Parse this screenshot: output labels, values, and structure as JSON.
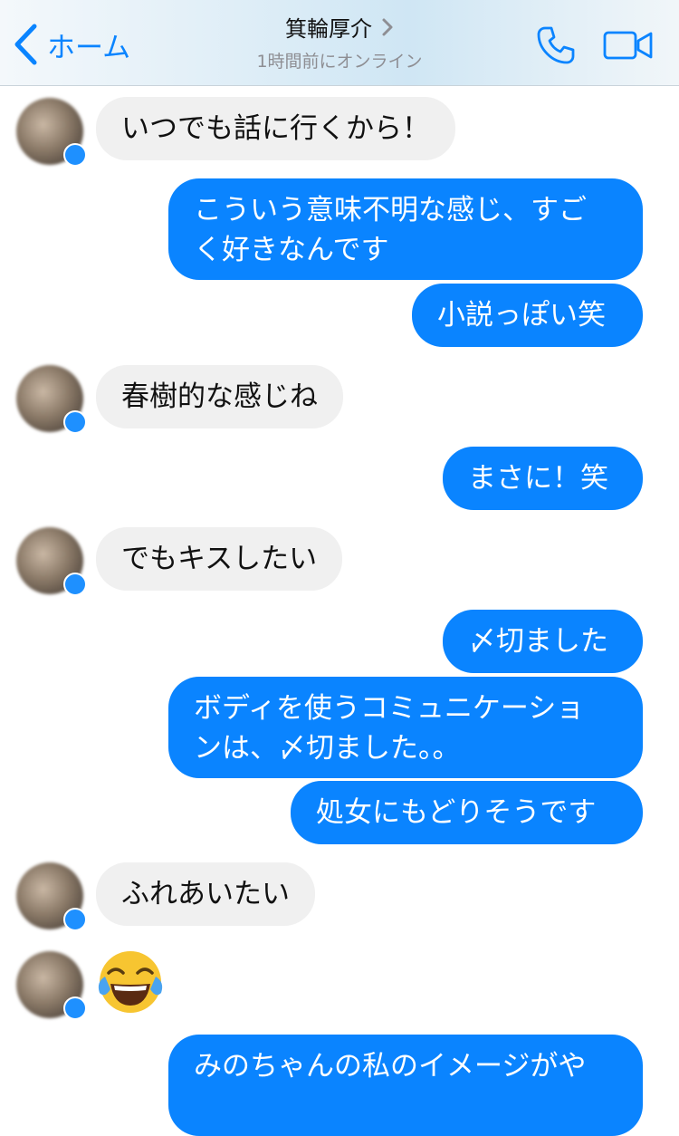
{
  "header": {
    "back_label": "ホーム",
    "contact_name": "箕輪厚介",
    "status": "1時間前にオンライン"
  },
  "messages": [
    {
      "side": "in",
      "text": "いつでも話に行くから！"
    },
    {
      "side": "out",
      "text": "こういう意味不明な感じ、すご\nく好きなんです"
    },
    {
      "side": "out",
      "text": "小説っぽい笑"
    },
    {
      "side": "in",
      "text": "春樹的な感じね"
    },
    {
      "side": "out",
      "text": "まさに！笑"
    },
    {
      "side": "in",
      "text": "でもキスしたい"
    },
    {
      "side": "out",
      "text": "〆切ました"
    },
    {
      "side": "out",
      "text": "ボディを使うコミュニケーショ\nンは、〆切ました。。"
    },
    {
      "side": "out",
      "text": "処女にもどりそうです"
    },
    {
      "side": "in",
      "text": "ふれあいたい"
    },
    {
      "side": "in",
      "emoji": "face-with-tears-of-joy"
    },
    {
      "side": "out",
      "text": "みのちゃんの私のイメージがや"
    }
  ],
  "colors": {
    "accent": "#0a84ff",
    "incoming_bubble": "#f0f0f0"
  }
}
